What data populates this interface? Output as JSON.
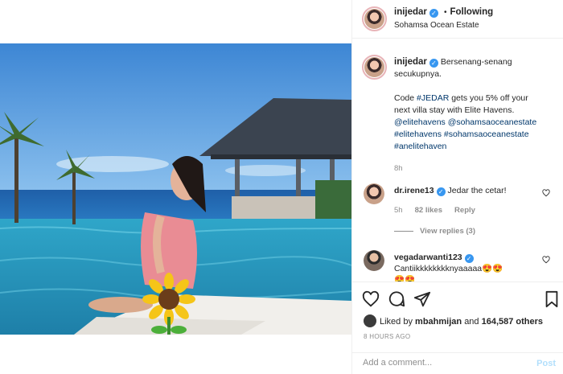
{
  "header": {
    "username": "inijedar",
    "separator": "•",
    "follow_label": "Following",
    "location": "Sohamsa Ocean Estate"
  },
  "caption": {
    "username": "inijedar",
    "text_line1": "Bersenang-senang",
    "text_line2": "secukupnya.",
    "promo_prefix": "Code",
    "promo_tag": "#JEDAR",
    "promo_rest1": "gets you 5% off your",
    "promo_rest2": "next villa stay with Elite Havens.",
    "mention1": "@elitehavens",
    "mention2": "@sohamsaoceanestate",
    "tag1": "#elitehavens",
    "tag2": "#sohamsaoceanestate",
    "tag3": "#anelitehaven",
    "age": "8h"
  },
  "comments": [
    {
      "username": "dr.irene13",
      "text": "Jedar the cetar!",
      "age": "5h",
      "likes": "82 likes",
      "reply_label": "Reply",
      "view_replies": "View replies (3)"
    },
    {
      "username": "vegadarwanti123",
      "text": "Cantiikkkkkkkknyaaaaa😍😍",
      "text2": "😍😍"
    }
  ],
  "actions": {
    "liked_by_prefix": "Liked by",
    "liked_by_user": "mbahmijan",
    "liked_by_and": "and",
    "liked_by_count": "164,587 others",
    "posted_ago": "8 HOURS AGO",
    "comment_placeholder": "Add a comment...",
    "post_label": "Post"
  },
  "icons": {
    "like": "heart-icon",
    "comment": "comment-icon",
    "share": "paper-plane-icon",
    "save": "bookmark-icon",
    "verified": "verified-badge-icon"
  },
  "colors": {
    "link": "#00376b",
    "verified": "#3897f0",
    "muted": "#8e8e8e",
    "post_button": "#b2dffc"
  }
}
